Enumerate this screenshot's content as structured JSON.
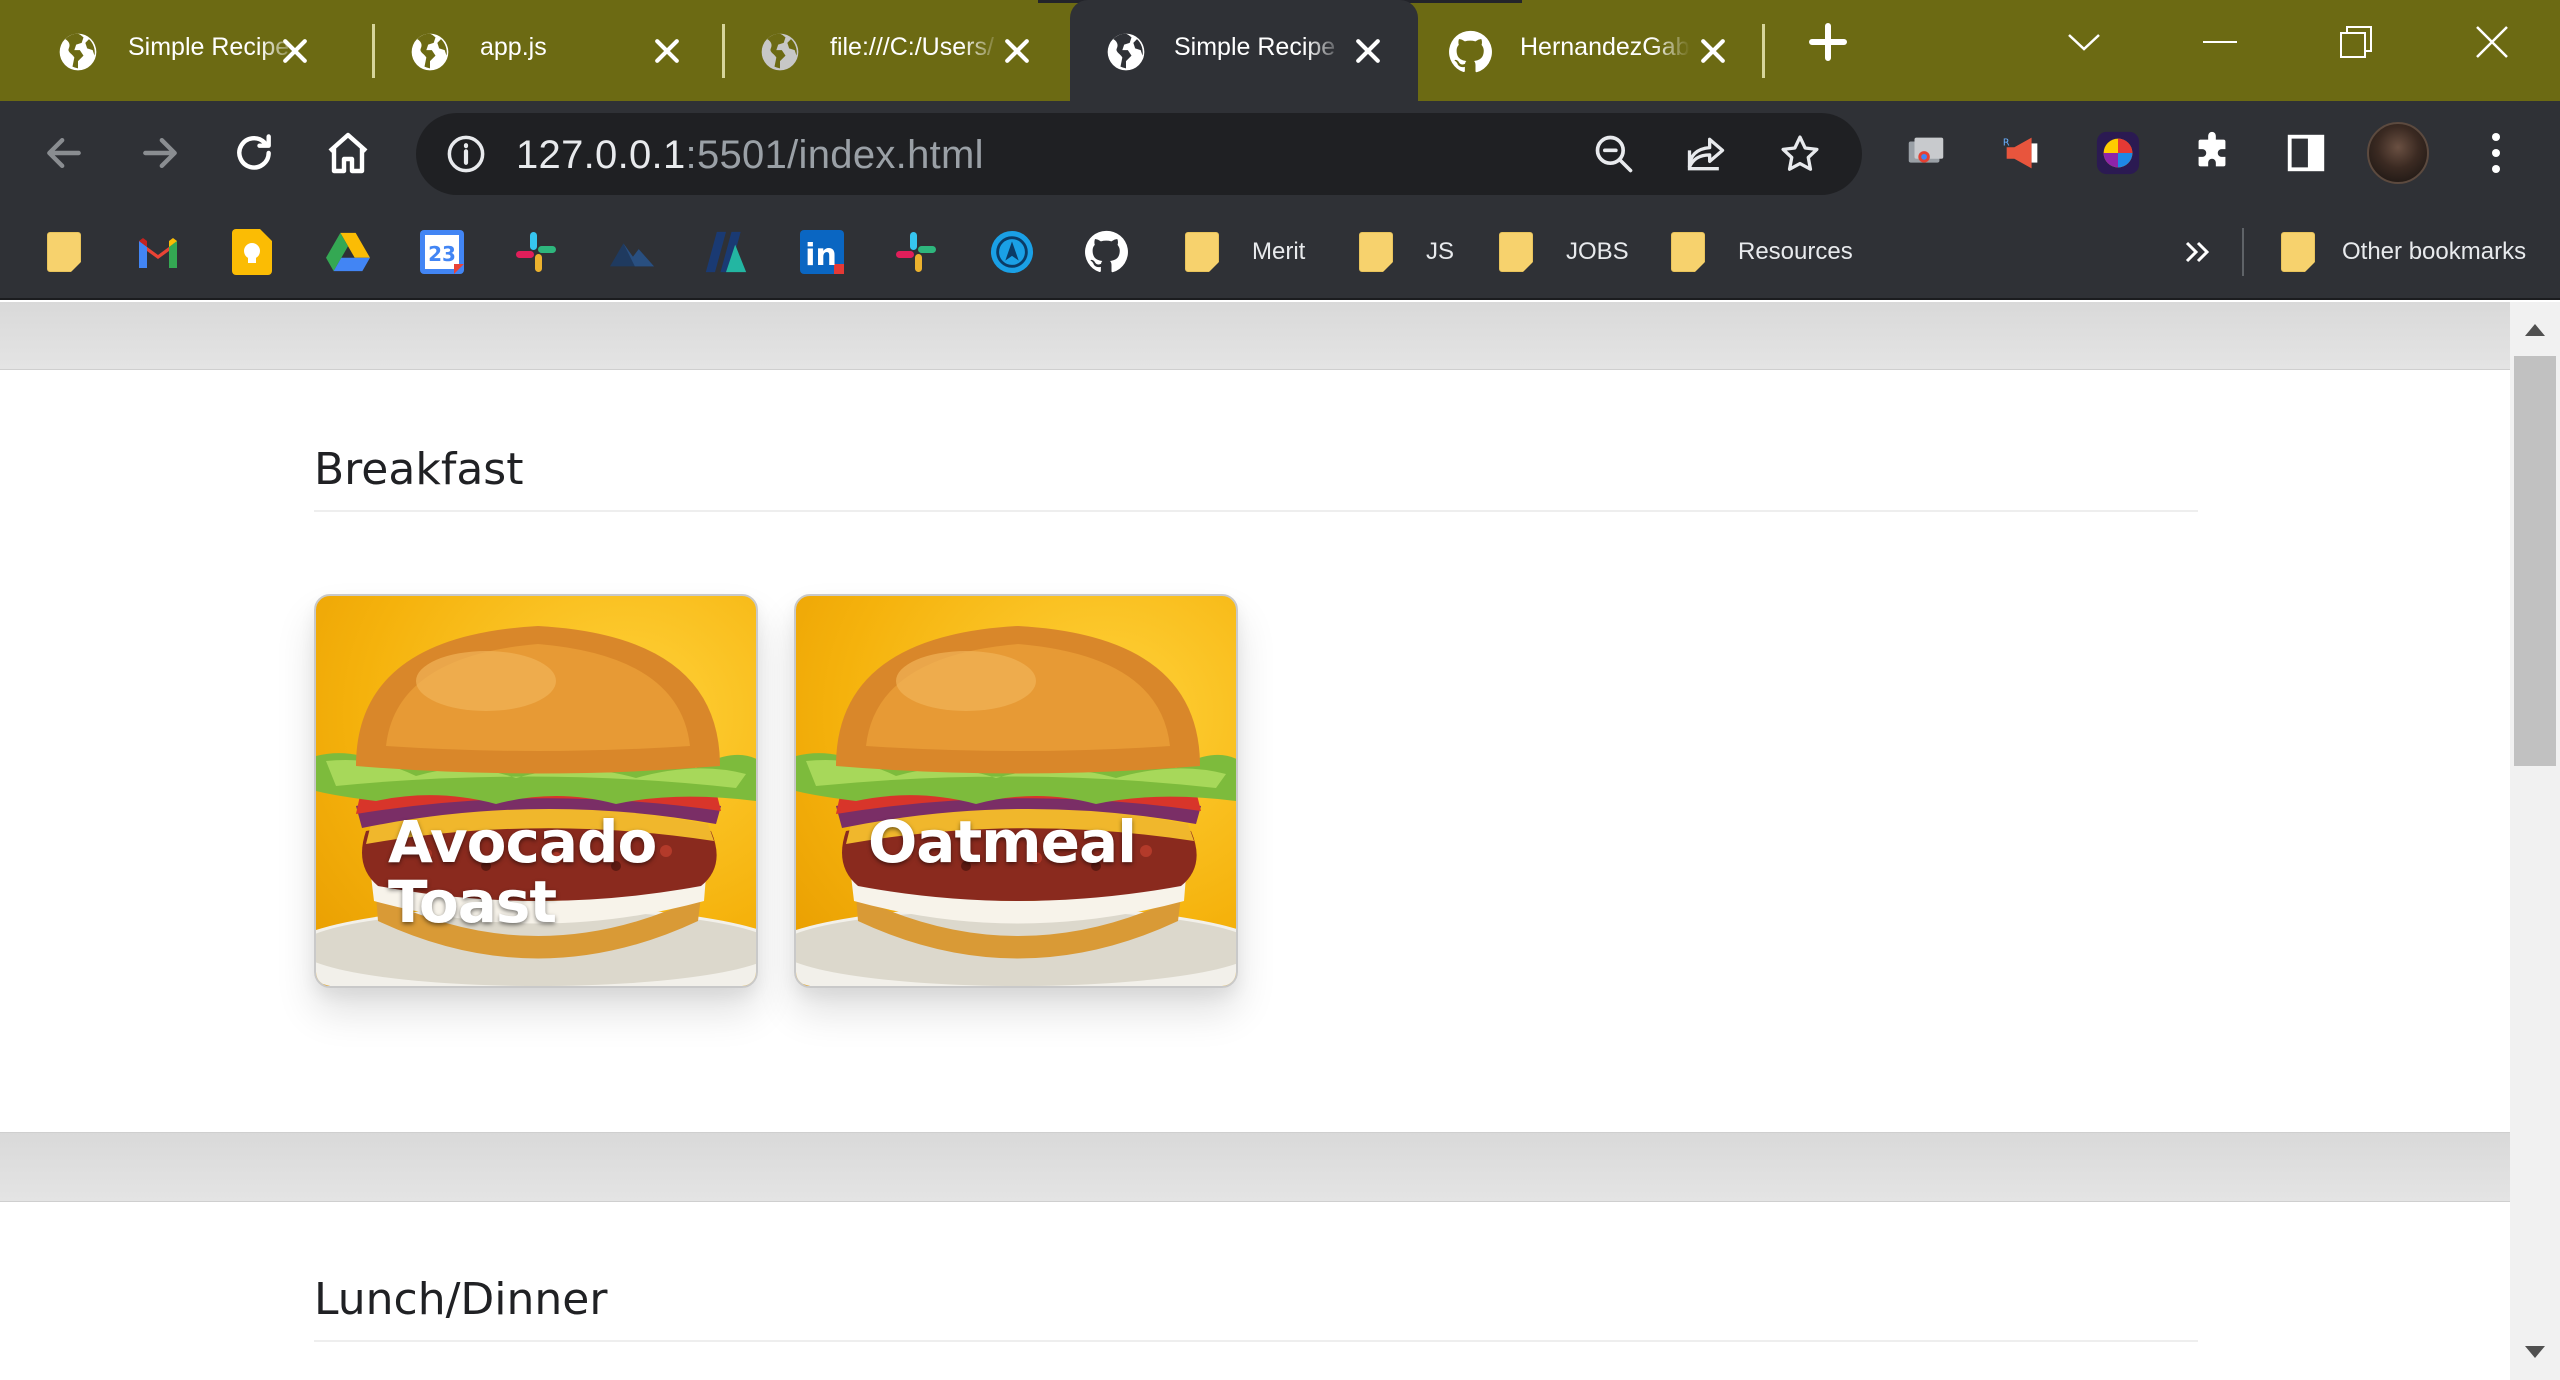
{
  "browser": {
    "tabs": [
      {
        "title": "Simple Recipe Book",
        "favicon": "globe-icon",
        "active": false
      },
      {
        "title": "app.js",
        "favicon": "globe-icon",
        "active": false
      },
      {
        "title": "file:///C:/Users/",
        "favicon": "globe-icon",
        "active": false
      },
      {
        "title": "Simple Recipe Book",
        "favicon": "globe-icon",
        "active": true
      },
      {
        "title": "HernandezGabriel",
        "favicon": "github-icon",
        "active": false
      }
    ],
    "address_bar": {
      "host": "127.0.0.1",
      "rest": ":5501/index.html"
    },
    "bookmarks": [
      {
        "label": "",
        "icon": "folder-icon"
      },
      {
        "label": "",
        "icon": "gmail-icon"
      },
      {
        "label": "",
        "icon": "keep-icon"
      },
      {
        "label": "",
        "icon": "drive-icon"
      },
      {
        "label": "",
        "icon": "calendar-icon",
        "text": "23"
      },
      {
        "label": "",
        "icon": "slack-icon"
      },
      {
        "label": "",
        "icon": "mountain-icon"
      },
      {
        "label": "",
        "icon": "film-icon"
      },
      {
        "label": "",
        "icon": "linkedin-icon",
        "text": "in"
      },
      {
        "label": "",
        "icon": "slack-icon"
      },
      {
        "label": "",
        "icon": "compass-icon"
      },
      {
        "label": "",
        "icon": "github-icon"
      },
      {
        "label": "Merit",
        "icon": "folder-icon"
      },
      {
        "label": "JS",
        "icon": "folder-icon"
      },
      {
        "label": "JOBS",
        "icon": "folder-icon"
      },
      {
        "label": "Resources",
        "icon": "folder-icon"
      }
    ],
    "other_bookmarks": "Other bookmarks",
    "colors": {
      "frame": "#6c6a13",
      "toolbar": "#2f3136",
      "omnibox": "#1f2023"
    }
  },
  "page": {
    "sections": [
      {
        "title": "Breakfast",
        "cards": [
          {
            "title": "Avocado Toast"
          },
          {
            "title": "Oatmeal"
          }
        ]
      },
      {
        "title": "Lunch/Dinner",
        "cards": []
      }
    ]
  }
}
